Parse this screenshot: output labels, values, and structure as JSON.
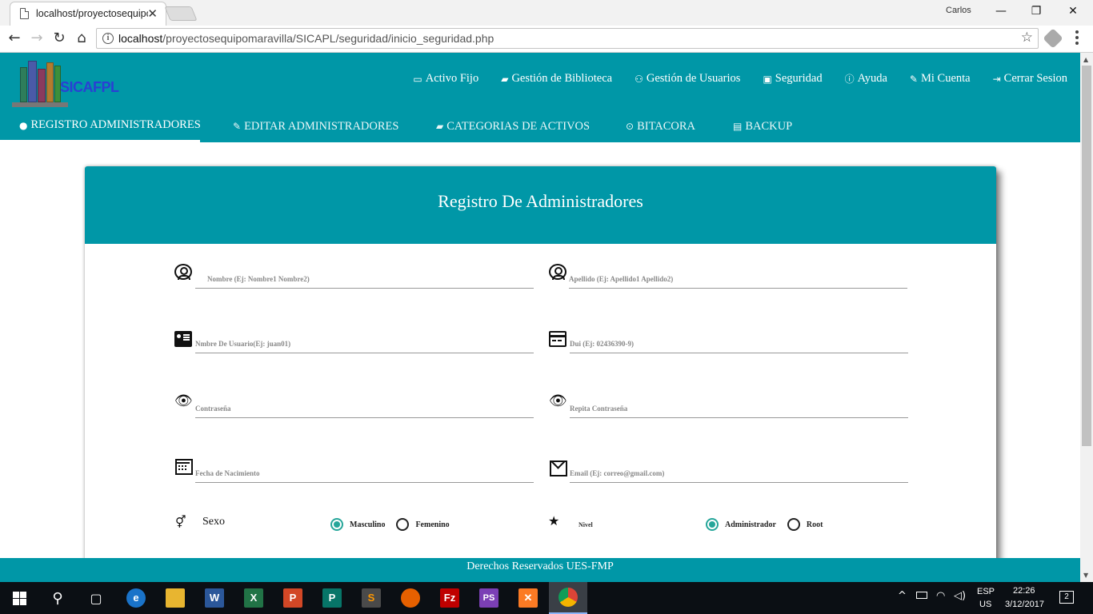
{
  "browser": {
    "tab_title": "localhost/proyectosequipomaravilla",
    "tab_close": "✕",
    "user": "Carlos",
    "window_controls": {
      "minimize": "—",
      "maximize": "❐",
      "close": "✕"
    },
    "url_host": "localhost",
    "url_path": "/proyectosequipomaravilla/SICAPL/seguridad/inicio_seguridad.php"
  },
  "header": {
    "logo_text": "SICAFPL",
    "top_nav": [
      {
        "icon": "monitor-icon",
        "label": "Activo Fijo"
      },
      {
        "icon": "book-icon",
        "label": "Gestión de Biblioteca"
      },
      {
        "icon": "users-icon",
        "label": "Gestión de Usuarios"
      },
      {
        "icon": "lock-icon",
        "label": "Seguridad"
      },
      {
        "icon": "info-icon",
        "label": "Ayuda"
      },
      {
        "icon": "wrench-icon",
        "label": "Mi Cuenta"
      },
      {
        "icon": "sign-out-icon",
        "label": "Cerrar Sesion"
      }
    ],
    "sub_nav": [
      {
        "icon": "user-icon",
        "label": "REGISTRO ADMINISTRADORES",
        "active": true
      },
      {
        "icon": "edit-icon",
        "label": "EDITAR ADMINISTRADORES",
        "active": false
      },
      {
        "icon": "book-icon",
        "label": "CATEGORIAS DE ACTIVOS",
        "active": false
      },
      {
        "icon": "history-icon",
        "label": "BITACORA",
        "active": false
      },
      {
        "icon": "save-icon",
        "label": "BACKUP",
        "active": false
      }
    ]
  },
  "form": {
    "title": "Registro De Administradores",
    "fields": {
      "nombre": {
        "placeholder": "Nombre (Ej: Nombre1 Nombre2)",
        "icon": "user-circle-icon"
      },
      "apellido": {
        "placeholder": "Apellido (Ej: Apellido1 Apellido2)",
        "icon": "user-circle-icon"
      },
      "usuario": {
        "placeholder": "Nmbre De Usuario(Ej: juan01)",
        "icon": "id-card-icon"
      },
      "dui": {
        "placeholder": "Dui (Ej: 02436390-9)",
        "icon": "credit-card-icon"
      },
      "password": {
        "placeholder": "Contraseña",
        "icon": "eye-icon"
      },
      "password2": {
        "placeholder": "Repita Contraseña",
        "icon": "eye-icon"
      },
      "fecha": {
        "placeholder": "Fecha de Nacimiento",
        "icon": "calendar-icon"
      },
      "email": {
        "placeholder": "Email (Ej: correo@gmail.com)",
        "icon": "envelope-icon"
      }
    },
    "sexo": {
      "label": "Sexo",
      "options": [
        "Masculino",
        "Femenino"
      ],
      "selected": "Masculino"
    },
    "nivel": {
      "label": "Nivel",
      "options": [
        "Administrador",
        "Root"
      ],
      "selected": "Administrador"
    }
  },
  "footer": {
    "text": "Derechos Reservados UES-FMP"
  },
  "taskbar": {
    "apps": [
      "start",
      "search",
      "task-view",
      "edge",
      "file-explorer",
      "word",
      "excel",
      "powerpoint",
      "publisher",
      "sublime-text",
      "firefox",
      "filezilla",
      "phpstorm",
      "xampp",
      "chrome"
    ],
    "lang_top": "ESP",
    "lang_bottom": "US",
    "time": "22:26",
    "date": "3/12/2017",
    "notifications": "2"
  }
}
